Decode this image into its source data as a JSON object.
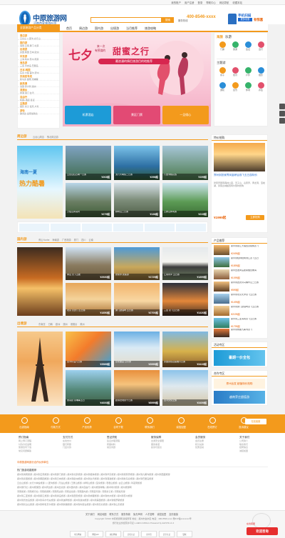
{
  "topbar": {
    "links": [
      "我的账户",
      "用户注册",
      "登录",
      "帮助中心",
      "网站导航",
      "收藏本站"
    ]
  },
  "header": {
    "logo_title": "中原旅游网",
    "logo_sub": "河南首家旅游社团",
    "search_placeholder": "请输入目的地、景点名称",
    "search_button": "搜索",
    "hot_words": "热门: 海南 云南 厦门 泰国 北京 华东 桂林 张家界 九寨沟",
    "hotline_label": "服务热线",
    "phone": "400-8546-xxxx",
    "mobile_title": "手机扫描",
    "mobile_sub": "有惊喜",
    "mobile_tag": "更多优惠"
  },
  "nav": {
    "category_label": "全部旅游产品分类",
    "items": [
      "首页",
      "周边游",
      "国内游",
      "出境游",
      "当月推荐",
      "旅游攻略"
    ]
  },
  "sidebar": [
    {
      "h": "周边游",
      "s": "云台山 八里沟 太行山"
    },
    {
      "h": "国内游",
      "s": "海南 云南 厦门 北京"
    },
    {
      "h": "出境游",
      "s": "泰国 韩国 日本 欧洲"
    },
    {
      "h": "华东游",
      "s": "上海 杭州 苏州 南京"
    },
    {
      "h": "海岛游",
      "s": "三亚 普吉岛 巴厘岛"
    },
    {
      "h": "日本.韩国",
      "s": "东京 大阪 首尔 济州"
    },
    {
      "h": "东南亚专线",
      "s": "新马泰 越南 柬埔寨"
    },
    {
      "h": "欧美澳",
      "s": "法国 意大利 澳洲"
    },
    {
      "h": "港澳台",
      "s": "香港 澳门 台湾"
    },
    {
      "h": "自由行",
      "s": "机票+酒店 签证"
    },
    {
      "h": "主题游",
      "s": "摄影 亲子 蜜月 户外"
    },
    {
      "h": "游轮",
      "s": "歌诗达 皇家加勒比"
    }
  ],
  "banner": {
    "big": "七夕",
    "line1": "来一次",
    "line2": "有预谋的",
    "title": "甜蜜之行",
    "sub": "最浪漫的情侣旅游目的地推荐",
    "promos": [
      "机票酒店",
      "景区门票",
      "一见倾心"
    ]
  },
  "rightbox": {
    "title1": "海旅",
    "title1b": "乐游",
    "icons1": [
      "门票",
      "旅游",
      "签证",
      "出行"
    ],
    "title2": "主题游",
    "icons2": [
      "亲子",
      "蜜月",
      "户外",
      "摄影",
      "游轮",
      "自驾",
      "休闲",
      "养生"
    ]
  },
  "sections": {
    "zhoubian": {
      "title": "周边游",
      "tabs": [
        "云台山周边",
        "豫北周边游"
      ],
      "items": [
        {
          "t": "云台山红石峡一日游",
          "p": "¥263起"
        },
        {
          "t": "太行大峡谷二日游",
          "p": "¥298起"
        },
        {
          "t": "八里沟桃花谷",
          "p": "¥199起"
        },
        {
          "t": "万仙山郭亮村",
          "p": "¥279起"
        },
        {
          "t": "嵖岈山二日游",
          "p": "¥138起"
        },
        {
          "t": "王屋山休闲游",
          "p": "¥215起"
        },
        {
          "t": "宝泉景区一日游",
          "p": "¥248起"
        }
      ],
      "promo_title": "海南一夏",
      "promo_big": "热力酷暑"
    },
    "guonei": {
      "title": "国内游",
      "tabs": [
        "黄山Yunhe",
        "海南游",
        "广西旅游",
        "厦门",
        "四川",
        "云南"
      ],
      "items": [
        {
          "t": "黄山 天下五绝",
          "p": "¥2920起"
        },
        {
          "t": "张家界 武陵源",
          "p": "¥1729起"
        },
        {
          "t": "桂林阳朔 五日游",
          "p": "¥2300起"
        },
        {
          "t": "江南水乡 五日游",
          "p": "¥1899起"
        },
        {
          "t": "北京 天安门 五日游",
          "p": "¥1850起"
        },
        {
          "t": "厦门鼓浪屿 五日游",
          "p": "¥2700起"
        },
        {
          "t": "三亚 双飞五日游",
          "p": "¥1420起"
        }
      ]
    },
    "chujing": {
      "title": "出境游",
      "tabs": [
        "东南亚",
        "日韩",
        "欧洲",
        "澳洲",
        "港澳台",
        "美洲"
      ],
      "items": [
        {
          "t": "台湾环岛八日游",
          "p": "¥3589起"
        },
        {
          "t": "台北故宫 日月潭",
          "p": "¥3999起"
        },
        {
          "t": "泰国曼谷芭提雅六日游",
          "p": "¥3419起"
        },
        {
          "t": "吴哥窟 柬埔寨五日",
          "p": "¥4600起"
        },
        {
          "t": "欧洲法瑞意十日游",
          "p": "¥8999起"
        },
        {
          "t": "台湾文化之旅",
          "p": "¥3459起"
        }
      ],
      "tower_label": "郑州出发 欧洲"
    }
  },
  "aside": {
    "featured_title": "特价抢购",
    "featured_text": "郑州到张家界凤凰峡谷双飞五日游特价",
    "featured_desc": "张家界国家森林公园、天子山、袁家界、黄龙洞、宝峰湖、凤凰古城超值特价限时抢购",
    "featured_price": "¥1999起",
    "featured_btn": "立即抢购",
    "ranking_title": "产品推荐",
    "ranking": [
      {
        "t": "郑州到丽江大理西双版纳双飞",
        "p": "¥2499起"
      },
      {
        "t": "郑州到桂林阳朔漓江双飞五日",
        "p": "¥1899起"
      },
      {
        "t": "郑州出发青岛蓬莱烟台威海",
        "p": "¥1099起"
      },
      {
        "t": "郑州到西安兵马俑华山二日游",
        "p": "¥599起"
      },
      {
        "t": "郑州到北京天津双飞五日游",
        "p": "¥1499起"
      },
      {
        "t": "郑州到厦门鼓浪屿双飞五日游",
        "p": "¥2199起"
      },
      {
        "t": "郑州到三亚海南双飞五日游",
        "p": "¥1799起"
      },
      {
        "t": "郑州到成都九寨沟双飞",
        "p": "¥2699起"
      },
      {
        "t": "郑州到张家界凤凰双卧",
        "p": "¥1399起"
      }
    ],
    "activity_title": "活动专区",
    "activity_promo": "暑期一价全包",
    "partner_title": "合作专区",
    "partner_text": "郑州出发 超值特价抢购",
    "partner_promo": "越南芽庄超值游"
  },
  "service": [
    "出游指南",
    "付款方式",
    "产品优势",
    "合同下载",
    "联系我们",
    "诚招加盟",
    "在线预订",
    "投诉建议"
  ],
  "links": {
    "cols": [
      {
        "h": "预订指南",
        "s": [
          "网上预订流程",
          "付款方式说明",
          "旅游合同下载",
          "常见问题解答"
        ]
      },
      {
        "h": "支付方式",
        "s": [
          "在线支付",
          "银行转账",
          "门店付款"
        ]
      },
      {
        "h": "签证须知",
        "s": [
          "签证办理流程",
          "所需材料",
          "常见问题"
        ]
      },
      {
        "h": "服务保障",
        "s": [
          "出游安全保障",
          "服务承诺",
          "投诉与建议"
        ]
      },
      {
        "h": "会员服务",
        "s": [
          "会员注册",
          "积分兑换",
          "优惠活动"
        ]
      },
      {
        "h": "关于我们",
        "s": [
          "公司简介",
          "联系我们",
          "招聘信息",
          "诚招加盟"
        ]
      }
    ],
    "partner_head": "中原旅游网部分合作伙伴单位",
    "friend_head": "热门旅游线路推荐",
    "rows": [
      "郑州到海南旅游 | 郑州到云南旅游 | 郑州到厦门旅游 | 郑州到北京旅游 | 郑州到桂林旅游 | 郑州到华东旅游 | 郑州到张家界旅游 | 郑州到九寨沟旅游 | 郑州到西藏旅游",
      "郑州到泰国旅游 | 郑州到韩国旅游 | 郑州到日本旅游 | 郑州到欧洲旅游 | 郑州到台湾旅游 | 郑州到港澳旅游 | 郑州到新马泰旅游 | 郑州到巴厘岛旅游",
      "云台山旅游 | 太行大峡谷旅游 | 八里沟旅游 | 万仙山旅游 | 王屋山旅游 | 嵖岈山旅游 | 宝泉旅游 | 老君山旅游 | 白云山旅游 | 鸡冠洞旅游",
      "郑州旅行社 | 郑州旅游团 | 郑州周边游 | 郑州出境游 | 郑州国内游 | 郑州自由行 | 郑州旅游攻略 | 郑州特价旅游 | 郑州旅游网",
      "河南旅游 | 河南旅行社 | 河南旅游网 | 河南周边游 | 河南出境游 | 河南国内游 | 河南自驾游 | 河南亲子游 | 河南蜜月游",
      "郑州到三亚旅游 | 郑州到丽江旅游 | 郑州到青岛旅游 | 郑州到西安旅游 | 郑州到成都旅游 | 郑州到杭州旅游 | 郑州到苏州旅游",
      "郑州到普吉岛旅游 | 郑州到马尔代夫旅游 | 郑州到迪拜旅游 | 郑州到澳洲旅游 | 郑州到美国旅游 | 郑州到俄罗斯旅游",
      "郑州到长白山旅游 | 郑州到呼伦贝尔旅游 | 郑州到新疆旅游 | 郑州到内蒙古旅游 | 郑州到东北旅游 | 郑州到山东旅游"
    ]
  },
  "footer": {
    "nav": [
      "关于我们",
      "网站地图",
      "联系方式",
      "服务条款",
      "免责声明",
      "人才招聘",
      "诚招加盟",
      "友情链接"
    ],
    "copyright": "Copyright ©2013 中原旅游网 版权所有 地址：郑州市金水区 电话：400-8546-xxxx 豫ICP备xxxxxxxx号",
    "copyright2": "旅行社业务经营许可证 L-HEN-CJ00xxx  Powered by ELISTA v1.2",
    "badges": [
      "可信网站",
      "网络110",
      "诚信网站",
      "实名认证",
      "支付宝",
      "安全认证",
      "银联"
    ],
    "chat_title": "欢迎咨询",
    "chat_sub": "在线客服",
    "chat_btn": "在线客服"
  },
  "colors": {
    "accent": "#f39a1c",
    "brand": "#15549d",
    "price": "#e95e00"
  }
}
